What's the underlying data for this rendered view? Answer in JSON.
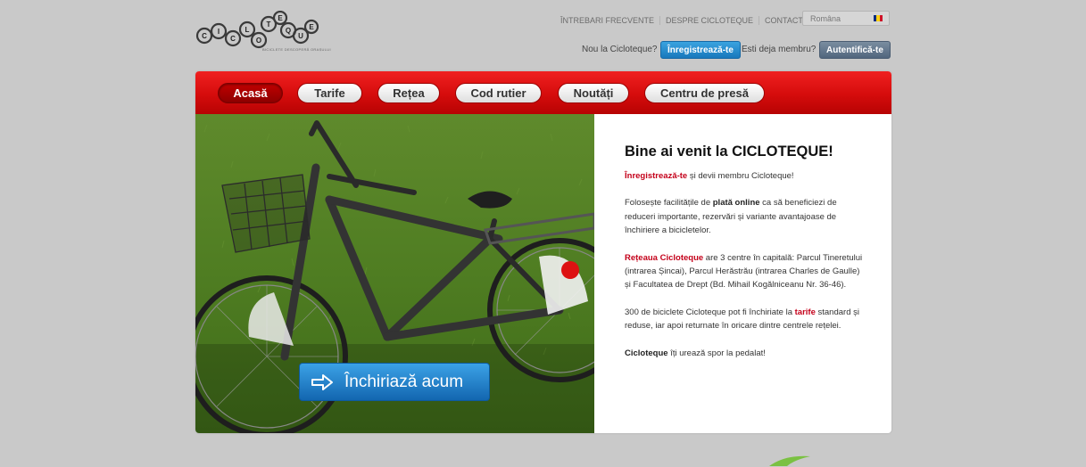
{
  "logo": {
    "letters": [
      "C",
      "I",
      "C",
      "L",
      "O",
      "T",
      "E",
      "Q",
      "U",
      "E"
    ],
    "tagline": "BICICLETE DESCOPERĂ ORAȘULUI"
  },
  "top_links": [
    "ÎNTREBARI FRECVENTE",
    "DESPRE CICLOTEQUE",
    "CONTACT"
  ],
  "language": {
    "selected": "Româna",
    "flag_colors": [
      "#002b7f",
      "#fcd116",
      "#ce1126"
    ]
  },
  "member": {
    "new_prompt": "Nou la Cicloteque?",
    "register_label": "Înregistrează-te",
    "existing_prompt": "Esti deja membru?",
    "login_label": "Autentifică-te"
  },
  "nav": [
    "Acasă",
    "Tarife",
    "Rețea",
    "Cod rutier",
    "Noutăți",
    "Centru de presă"
  ],
  "hero": {
    "cta_label": "Închiriază acum"
  },
  "welcome": {
    "title": "Bine ai venit la CICLOTEQUE!",
    "p1_link": "Înregistrează-te",
    "p1_rest": " și devii membru Cicloteque!",
    "p2_a": "Folosește facilitățile de ",
    "p2_b": "plată online",
    "p2_c": " ca să beneficiezi de reduceri importante, rezervări și variante avantajoase de închiriere a bicicletelor.",
    "p3_link": "Rețeaua Cicloteque",
    "p3_rest": " are 3 centre în capitală: Parcul Tineretului (intrarea Șincai), Parcul Herăstrău (intrarea Charles de Gaulle) și Facultatea de Drept (Bd. Mihail Kogălniceanu Nr. 36-46).",
    "p4_a": "300 de biciclete Cicloteque pot fi închiriate la ",
    "p4_link": "tarife",
    "p4_b": " standard și reduse, iar apoi returnate în oricare dintre centrele rețelei.",
    "p5_bold": "Cicloteque",
    "p5_rest": " îți urează spor la pedalat!"
  },
  "colors": {
    "nav_red": "#d50c0c",
    "accent_blue": "#1878bc",
    "link_red": "#c4001a"
  }
}
